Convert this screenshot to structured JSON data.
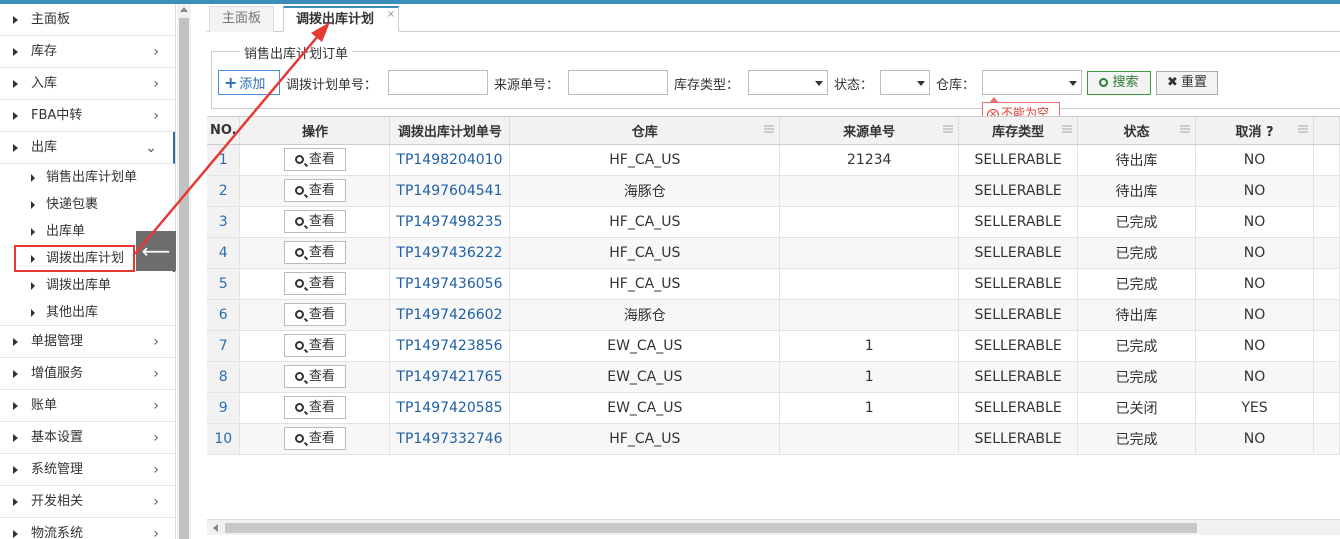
{
  "sidebar": {
    "items": [
      {
        "label": "主面板",
        "has_chevron": false
      },
      {
        "label": "库存",
        "has_chevron": true
      },
      {
        "label": "入库",
        "has_chevron": true
      },
      {
        "label": "FBA中转",
        "has_chevron": true
      },
      {
        "label": "出库",
        "has_chevron": true,
        "open": true
      },
      {
        "label": "单据管理",
        "has_chevron": true
      },
      {
        "label": "增值服务",
        "has_chevron": true
      },
      {
        "label": "账单",
        "has_chevron": true
      },
      {
        "label": "基本设置",
        "has_chevron": true
      },
      {
        "label": "系统管理",
        "has_chevron": true
      },
      {
        "label": "开发相关",
        "has_chevron": true
      },
      {
        "label": "物流系统",
        "has_chevron": true
      }
    ],
    "sub_items": [
      "销售出库计划单",
      "快递包裹",
      "出库单",
      "调拨出库计划",
      "调拨出库单",
      "其他出库"
    ],
    "active_sub": "调拨出库计划",
    "collapse_arrow": "⟵"
  },
  "tabs": [
    {
      "label": "主面板"
    },
    {
      "label": "调拨出库计划",
      "active": true,
      "close": "×"
    }
  ],
  "filter": {
    "legend": "销售出库计划订单",
    "add_label": "添加",
    "plan_no_label": "调拨计划单号：",
    "source_no_label": "来源单号：",
    "stock_type_label": "库存类型：",
    "status_label": "状态：",
    "warehouse_label": "仓库：",
    "search_label": "搜索",
    "reset_label": "重置",
    "warehouse_error": "不能为空"
  },
  "grid": {
    "headers": [
      "NO.",
      "操作",
      "调拨出库计划单号",
      "仓库",
      "来源单号",
      "库存类型",
      "状态",
      "取消 ?"
    ],
    "view_label": "查看",
    "rows": [
      {
        "no": "1",
        "plan": "TP1498204010",
        "warehouse": "HF_CA_US",
        "source": "21234",
        "stock_type": "SELLERABLE",
        "status": "待出库",
        "cancel": "NO"
      },
      {
        "no": "2",
        "plan": "TP1497604541",
        "warehouse": "海豚仓",
        "source": "",
        "stock_type": "SELLERABLE",
        "status": "待出库",
        "cancel": "NO"
      },
      {
        "no": "3",
        "plan": "TP1497498235",
        "warehouse": "HF_CA_US",
        "source": "",
        "stock_type": "SELLERABLE",
        "status": "已完成",
        "cancel": "NO"
      },
      {
        "no": "4",
        "plan": "TP1497436222",
        "warehouse": "HF_CA_US",
        "source": "",
        "stock_type": "SELLERABLE",
        "status": "已完成",
        "cancel": "NO"
      },
      {
        "no": "5",
        "plan": "TP1497436056",
        "warehouse": "HF_CA_US",
        "source": "",
        "stock_type": "SELLERABLE",
        "status": "已完成",
        "cancel": "NO"
      },
      {
        "no": "6",
        "plan": "TP1497426602",
        "warehouse": "海豚仓",
        "source": "",
        "stock_type": "SELLERABLE",
        "status": "待出库",
        "cancel": "NO"
      },
      {
        "no": "7",
        "plan": "TP1497423856",
        "warehouse": "EW_CA_US",
        "source": "1",
        "stock_type": "SELLERABLE",
        "status": "已完成",
        "cancel": "NO"
      },
      {
        "no": "8",
        "plan": "TP1497421765",
        "warehouse": "EW_CA_US",
        "source": "1",
        "stock_type": "SELLERABLE",
        "status": "已完成",
        "cancel": "NO"
      },
      {
        "no": "9",
        "plan": "TP1497420585",
        "warehouse": "EW_CA_US",
        "source": "1",
        "stock_type": "SELLERABLE",
        "status": "已关闭",
        "cancel": "YES"
      },
      {
        "no": "10",
        "plan": "TP1497332746",
        "warehouse": "HF_CA_US",
        "source": "",
        "stock_type": "SELLERABLE",
        "status": "已完成",
        "cancel": "NO"
      }
    ]
  },
  "colors": {
    "accent": "#3c8dbc",
    "link": "#1e5fa5",
    "annotation": "#e53935",
    "search": "#2e7d32"
  }
}
